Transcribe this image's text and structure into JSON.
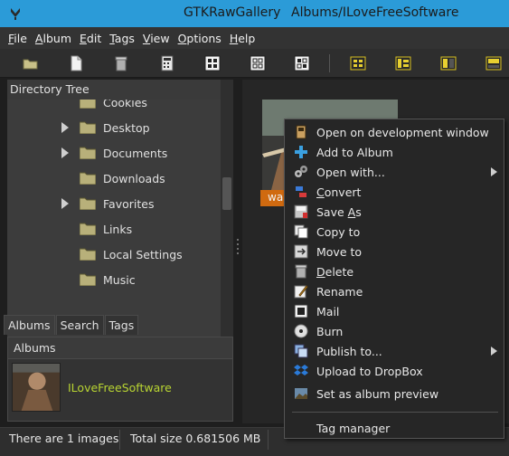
{
  "titlebar": {
    "app_name": "GTKRawGallery",
    "window_title": "Albums/ILoveFreeSoftware"
  },
  "menubar": {
    "items": [
      {
        "label": "File",
        "ul": "F",
        "rest": "ile"
      },
      {
        "label": "Album",
        "ul": "A",
        "rest": "lbum"
      },
      {
        "label": "Edit",
        "ul": "E",
        "rest": "dit"
      },
      {
        "label": "Tags",
        "ul": "T",
        "rest": "ags"
      },
      {
        "label": "View",
        "ul": "V",
        "rest": "iew"
      },
      {
        "label": "Options",
        "ul": "O",
        "rest": "ptions"
      },
      {
        "label": "Help",
        "ul": "H",
        "rest": "elp"
      }
    ]
  },
  "toolbar": {
    "buttons": [
      "open-folder-icon",
      "new-file-icon",
      "trash-icon",
      "calculator-icon",
      "grid-1-icon",
      "grid-2-icon",
      "grid-3-icon",
      "layout-grid-icon",
      "layout-side-icon",
      "layout-left-icon",
      "layout-bottom-icon"
    ]
  },
  "directory_tree": {
    "header": "Directory Tree",
    "items": [
      {
        "label": "Cookies",
        "expandable": false
      },
      {
        "label": "Desktop",
        "expandable": true
      },
      {
        "label": "Documents",
        "expandable": true
      },
      {
        "label": "Downloads",
        "expandable": false
      },
      {
        "label": "Favorites",
        "expandable": true
      },
      {
        "label": "Links",
        "expandable": false
      },
      {
        "label": "Local Settings",
        "expandable": false
      },
      {
        "label": "Music",
        "expandable": false
      }
    ]
  },
  "tabs": [
    {
      "label": "Albums",
      "active": true
    },
    {
      "label": "Search",
      "active": false
    },
    {
      "label": "Tags",
      "active": false
    }
  ],
  "albums": {
    "header": "Albums",
    "items": [
      {
        "name": "ILoveFreeSoftware"
      }
    ]
  },
  "thumbnail": {
    "caption": "wa"
  },
  "status": {
    "count": "There are 1 images",
    "size": "Total size 0.681506 MB"
  },
  "context_menu": {
    "items": [
      {
        "label": "Open on development window",
        "icon": "monitor-icon",
        "submenu": false
      },
      {
        "label": "Add to Album",
        "icon": "plus-icon",
        "submenu": false
      },
      {
        "label": "Open with...",
        "icon": "gears-icon",
        "submenu": true
      },
      {
        "label": "Convert",
        "icon": "convert-icon",
        "submenu": false,
        "ul": "C",
        "rest": "onvert"
      },
      {
        "label": "Save As",
        "icon": "save-as-icon",
        "submenu": false,
        "ul": "Save ",
        "ul2": "A",
        "rest": "s"
      },
      {
        "label": "Copy to",
        "icon": "copy-icon",
        "submenu": false
      },
      {
        "label": "Move to",
        "icon": "move-icon",
        "submenu": false
      },
      {
        "label": "Delete",
        "icon": "delete-icon",
        "submenu": false,
        "ul": "D",
        "rest": "elete"
      },
      {
        "label": "Rename",
        "icon": "rename-icon",
        "submenu": false
      },
      {
        "label": "Mail",
        "icon": "mail-icon",
        "submenu": false
      },
      {
        "label": "Burn",
        "icon": "disc-icon",
        "submenu": false
      },
      {
        "label": "Publish to...",
        "icon": "publish-icon",
        "submenu": true
      },
      {
        "label": "Upload to DropBox",
        "icon": "dropbox-icon",
        "submenu": false
      },
      {
        "label": "Set as album preview",
        "icon": "image-icon",
        "submenu": false
      }
    ],
    "footer_item": {
      "label": "Tag manager"
    }
  }
}
